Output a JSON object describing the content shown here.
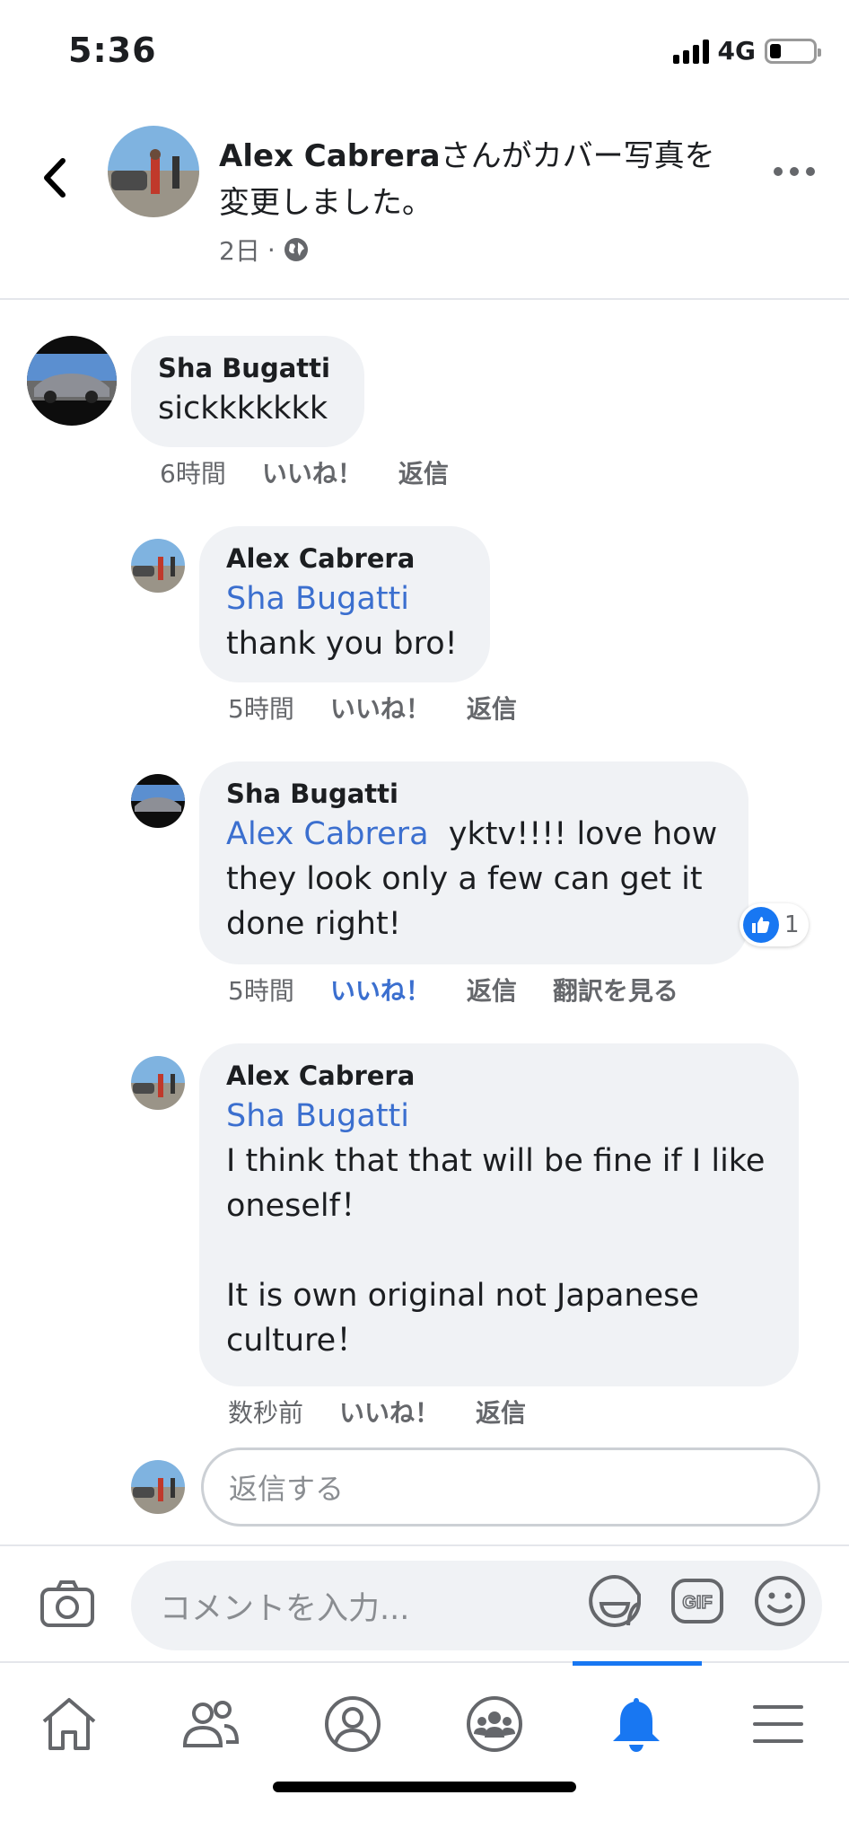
{
  "status_bar": {
    "time": "5:36",
    "network": "4G"
  },
  "post_header": {
    "author": "Alex Cabrera",
    "action_text": "さんがカバー写真を変更しました。",
    "time": "2日",
    "separator": "·",
    "privacy_icon": "globe-icon"
  },
  "comments": [
    {
      "author": "Sha Bugatti",
      "mention": "",
      "text": "sickkkkkkk",
      "time": "6時間",
      "like_label": "いいね！",
      "reply_label": "返信"
    },
    {
      "author": "Alex Cabrera",
      "mention": "Sha Bugatti",
      "text": "thank you bro!",
      "time": "5時間",
      "like_label": "いいね！",
      "reply_label": "返信"
    },
    {
      "author": "Sha Bugatti",
      "mention": "Alex Cabrera",
      "text": "yktv!!!! love how they look only a few can get it done right!",
      "time": "5時間",
      "like_label": "いいね！",
      "reply_label": "返信",
      "translate_label": "翻訳を見る",
      "reaction_count": "1",
      "liked_by_viewer": true
    },
    {
      "author": "Alex Cabrera",
      "mention": "Sha Bugatti",
      "text": "I think that that will be fine if I like oneself！\n\nIt is own original not Japanese culture！",
      "time": "数秒前",
      "like_label": "いいね！",
      "reply_label": "返信"
    }
  ],
  "reply_input": {
    "placeholder": "返信する"
  },
  "composer": {
    "placeholder": "コメントを入力...",
    "icons": [
      "camera-icon",
      "sticker-icon",
      "gif-icon",
      "emoji-icon"
    ],
    "gif_label": "GIF"
  },
  "tab_bar": {
    "tabs": [
      "home-icon",
      "friends-icon",
      "profile-icon",
      "groups-icon",
      "notifications-icon",
      "menu-icon"
    ],
    "active": "notifications-icon"
  },
  "colors": {
    "accent": "#1877f2",
    "mention": "#3b6fcf",
    "bubble": "#f0f2f5",
    "meta": "#65676b"
  }
}
